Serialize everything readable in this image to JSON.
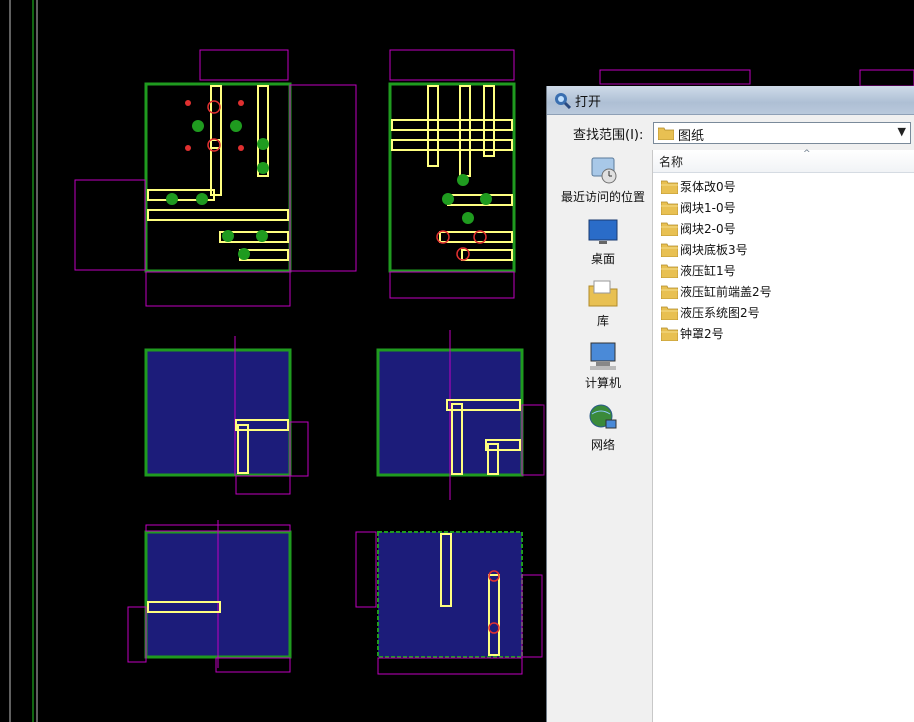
{
  "dialog": {
    "title": "打开",
    "look_in_label": "查找范围(I):",
    "look_in_value": "图纸",
    "column_name_header": "名称",
    "places": [
      {
        "label": "最近访问的位置",
        "icon": "recent-places-icon"
      },
      {
        "label": "桌面",
        "icon": "desktop-icon"
      },
      {
        "label": "库",
        "icon": "libraries-icon"
      },
      {
        "label": "计算机",
        "icon": "computer-icon"
      },
      {
        "label": "网络",
        "icon": "network-icon"
      }
    ],
    "files": [
      {
        "name": "泵体改0号"
      },
      {
        "name": "阀块1-0号"
      },
      {
        "name": "阀块2-0号"
      },
      {
        "name": "阀块底板3号"
      },
      {
        "name": "液压缸1号"
      },
      {
        "name": "液压缸前端盖2号"
      },
      {
        "name": "液压系统图2号"
      },
      {
        "name": "钟罩2号"
      }
    ]
  },
  "cad": {
    "background": "#000000",
    "outline_color": "#1f9b1f",
    "dimension_color": "#c000c0",
    "hatch_color": "#1c1c7a",
    "bore_color": "#ffff80",
    "center_color": "#e03030"
  }
}
